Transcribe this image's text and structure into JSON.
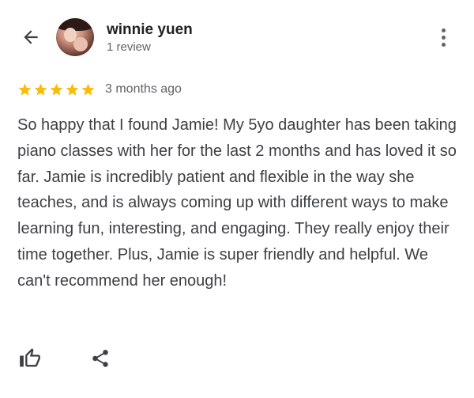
{
  "reviewer": {
    "name": "winnie yuen",
    "review_count": "1 review"
  },
  "review": {
    "rating": 5,
    "max_rating": 5,
    "time_ago": "3 months ago",
    "text": "So happy that I found Jamie! My 5yo daughter has been taking piano classes with her for the last 2 months and has loved it so far. Jamie is incredibly patient and flexible in the way she teaches, and is always coming up with different ways to make learning fun, interesting, and engaging. They really enjoy their time together. Plus, Jamie is super friendly and helpful. We can't recommend her enough!"
  },
  "icons": {
    "back": "arrow-back-icon",
    "more": "more-vert-icon",
    "star": "star-icon",
    "like": "thumb-up-icon",
    "share": "share-icon"
  },
  "colors": {
    "star": "#fbbc04",
    "name": "#202124",
    "text": "#3c4043",
    "secondary": "#5f6368"
  }
}
